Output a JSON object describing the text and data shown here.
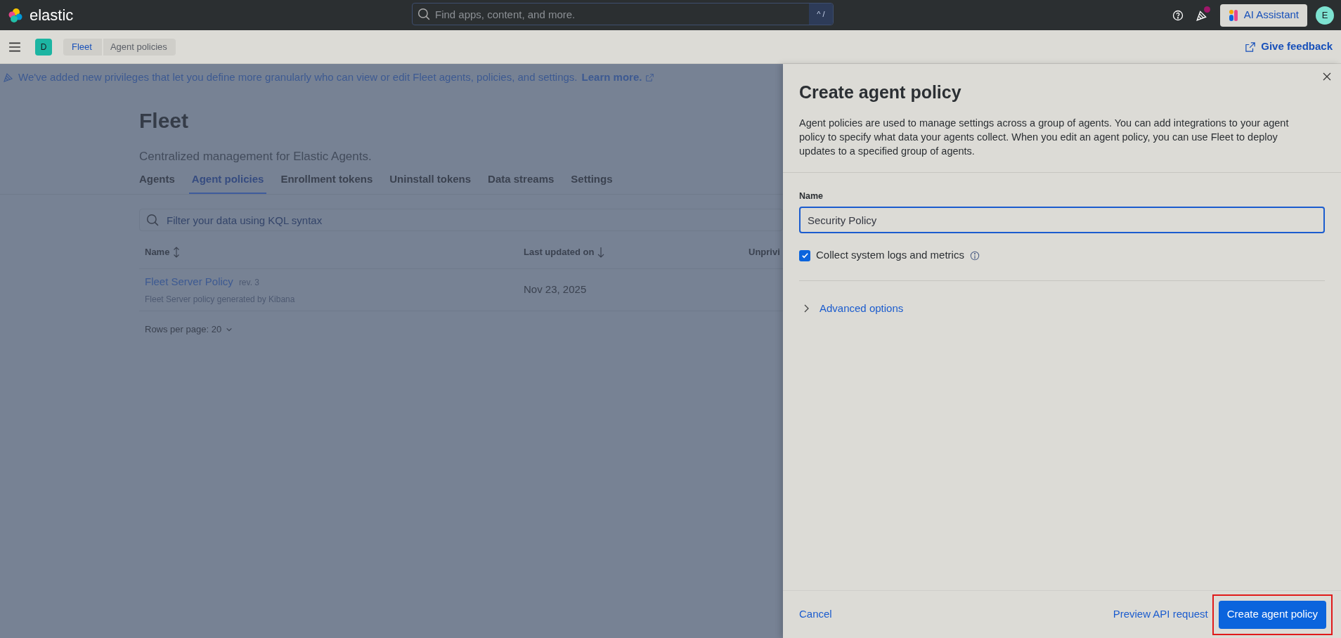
{
  "header": {
    "logo_text": "elastic",
    "search": {
      "placeholder": "Find apps, content, and more.",
      "shortcut": "^ /"
    },
    "news_unread": true,
    "ai_button": "AI Assistant",
    "avatar": "E"
  },
  "breadcrumb_bar": {
    "space_badge": "D",
    "crumbs": [
      {
        "label": "Fleet",
        "link": true
      },
      {
        "label": "Agent policies",
        "link": false
      }
    ],
    "feedback": "Give feedback"
  },
  "banner": {
    "text": "We've added new privileges that let you define more granularly who can view or edit Fleet agents, policies, and settings.",
    "link": "Learn more."
  },
  "page": {
    "title": "Fleet",
    "subtitle": "Centralized management for Elastic Agents.",
    "tabs": [
      {
        "label": "Agents",
        "selected": false
      },
      {
        "label": "Agent policies",
        "selected": true
      },
      {
        "label": "Enrollment tokens",
        "selected": false
      },
      {
        "label": "Uninstall tokens",
        "selected": false
      },
      {
        "label": "Data streams",
        "selected": false
      },
      {
        "label": "Settings",
        "selected": false
      }
    ],
    "filter": {
      "placeholder": "Filter your data using KQL syntax"
    },
    "table": {
      "columns": [
        {
          "label": "Name",
          "kind": "sortable"
        },
        {
          "label": "Last updated on",
          "kind": "sorted"
        },
        {
          "label": "Unprivi",
          "kind": "plain"
        }
      ],
      "rows": [
        {
          "name": "Fleet Server Policy",
          "revision": "rev. 3",
          "description": "Fleet Server policy generated by Kibana",
          "updated": "Nov 23, 2025"
        }
      ]
    },
    "rows_per_page": "Rows per page: 20"
  },
  "flyout": {
    "title": "Create agent policy",
    "description": "Agent policies are used to manage settings across a group of agents. You can add integrations to your agent policy to specify what data your agents collect. When you edit an agent policy, you can use Fleet to deploy updates to a specified group of agents.",
    "name_label": "Name",
    "name_value": "Security Policy",
    "collect_checkbox": {
      "label": "Collect system logs and metrics",
      "checked": true
    },
    "advanced": {
      "label": "Advanced options",
      "expanded": false
    },
    "footer": {
      "cancel": "Cancel",
      "preview": "Preview API request",
      "submit": "Create agent policy",
      "submit_highlighted": true
    }
  }
}
